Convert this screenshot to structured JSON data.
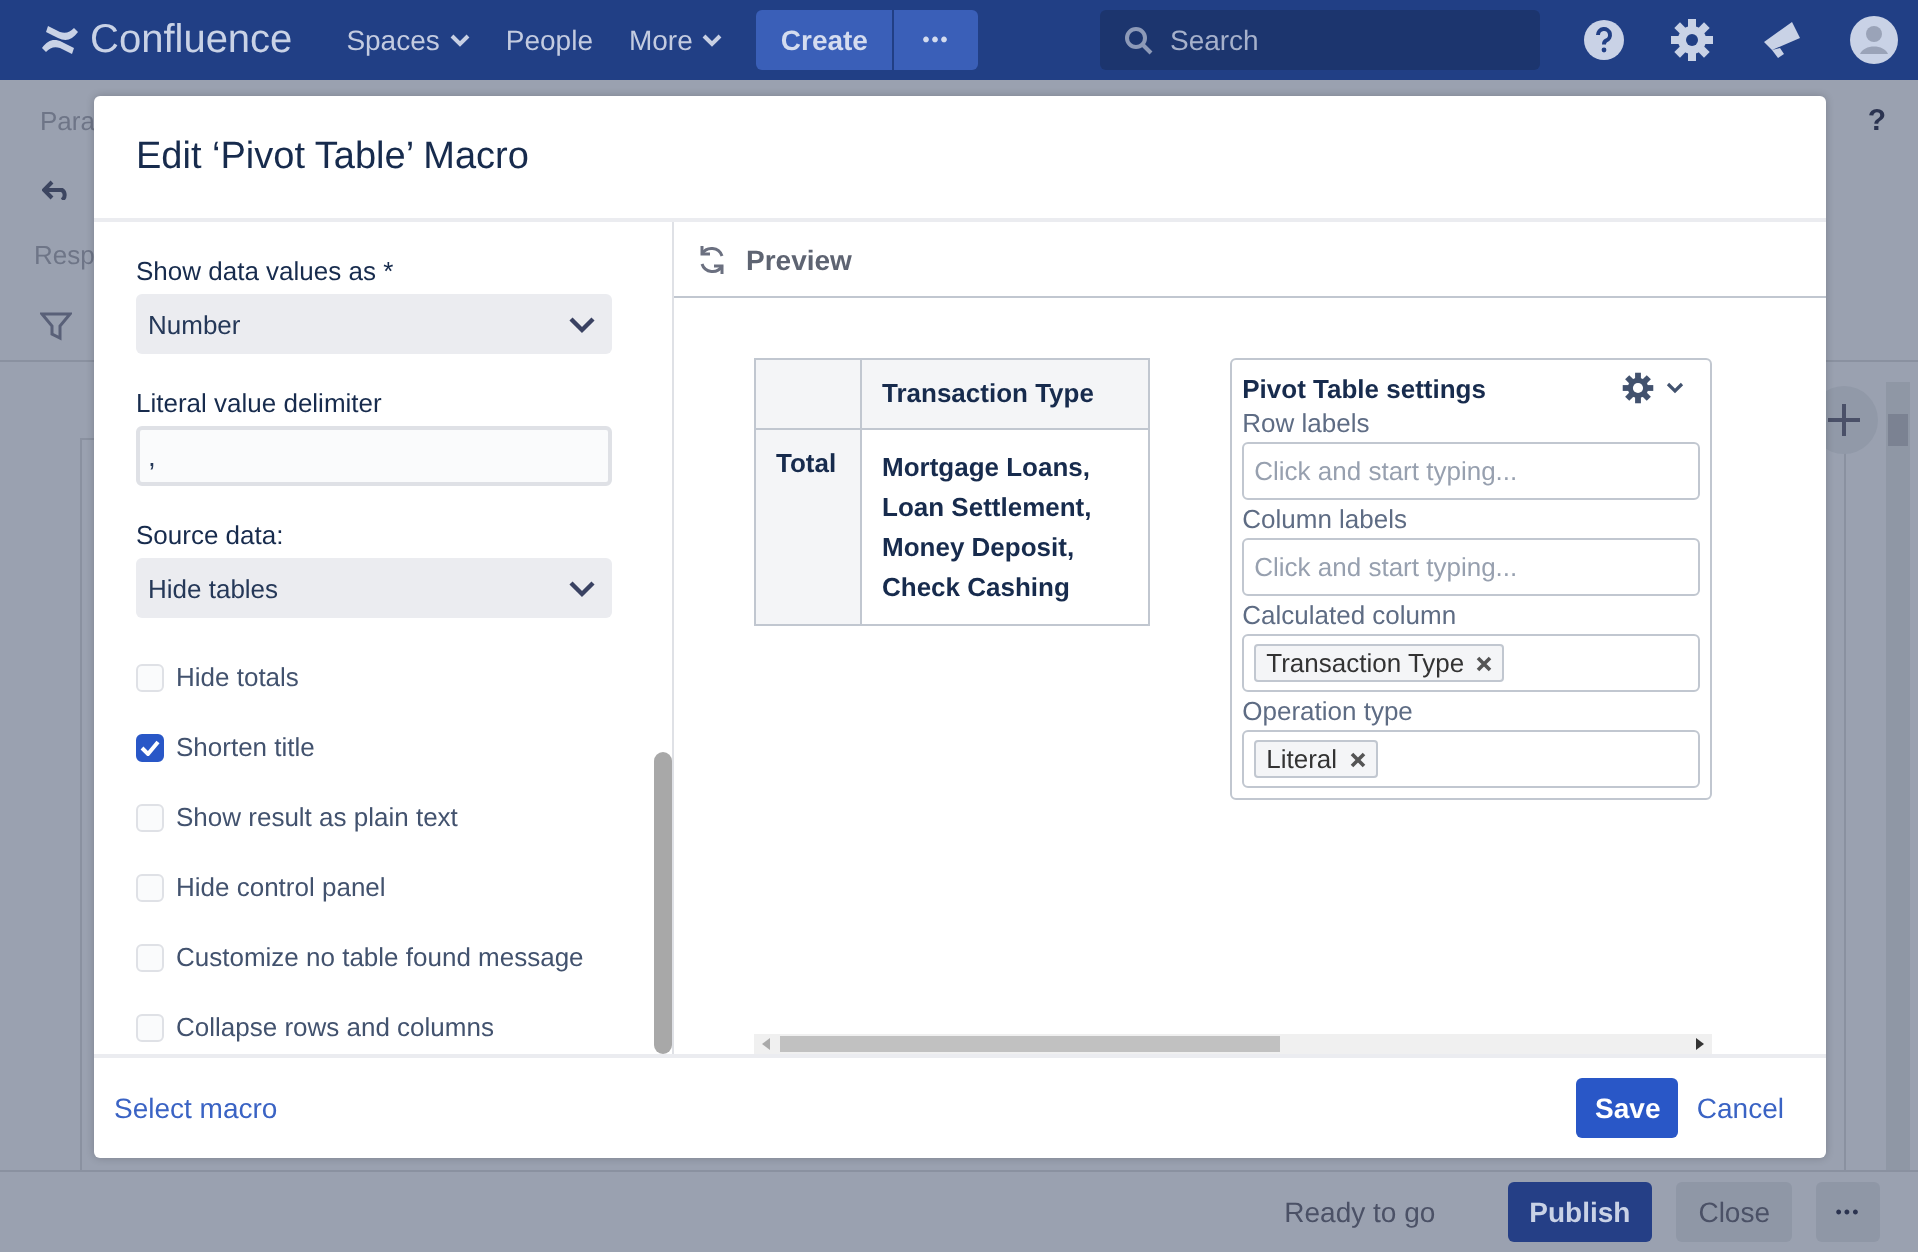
{
  "nav": {
    "logo": "Confluence",
    "items": [
      {
        "label": "Spaces",
        "dropdown": true
      },
      {
        "label": "People",
        "dropdown": false
      },
      {
        "label": "More",
        "dropdown": true
      }
    ],
    "create": "Create",
    "more": "•••",
    "search": {
      "placeholder": "Search"
    }
  },
  "editor": {
    "style_text": "Para",
    "help": "?",
    "row_text": "Resp"
  },
  "dialog": {
    "title": "Edit ‘Pivot Table’ Macro",
    "fields": [
      {
        "kind": "select",
        "label": "Show data values as *",
        "value": "Number"
      },
      {
        "kind": "text",
        "label": "Literal value delimiter",
        "value": ","
      },
      {
        "kind": "select",
        "label": "Source data:",
        "value": "Hide tables"
      },
      {
        "kind": "checkbox",
        "label": "Hide totals",
        "checked": false
      },
      {
        "kind": "checkbox",
        "label": "Shorten title",
        "checked": true
      },
      {
        "kind": "checkbox",
        "label": "Show result as plain text",
        "checked": false
      },
      {
        "kind": "checkbox",
        "label": "Hide control panel",
        "checked": false
      },
      {
        "kind": "checkbox",
        "label": "Customize no table found message",
        "checked": false
      },
      {
        "kind": "checkbox",
        "label": "Collapse rows and columns",
        "checked": false
      }
    ],
    "preview": {
      "label": "Preview",
      "table": {
        "column": "Transaction Type",
        "rows": [
          {
            "label": "Total",
            "value": "Mortgage Loans, Loan Settlement, Money Deposit, Check Cashing"
          }
        ]
      },
      "settings": {
        "title": "Pivot Table settings",
        "fields": [
          {
            "label": "Row labels",
            "placeholder": "Click and start typing..."
          },
          {
            "label": "Column labels",
            "placeholder": "Click and start typing..."
          },
          {
            "label": "Calculated column",
            "tags": [
              "Transaction Type"
            ]
          },
          {
            "label": "Operation type",
            "tags": [
              "Literal"
            ]
          }
        ]
      }
    },
    "select_macro": "Select macro",
    "save": "Save",
    "cancel": "Cancel"
  },
  "status_bar": {
    "status": "Ready to go",
    "publish": "Publish",
    "close": "Close",
    "more": "•••"
  }
}
